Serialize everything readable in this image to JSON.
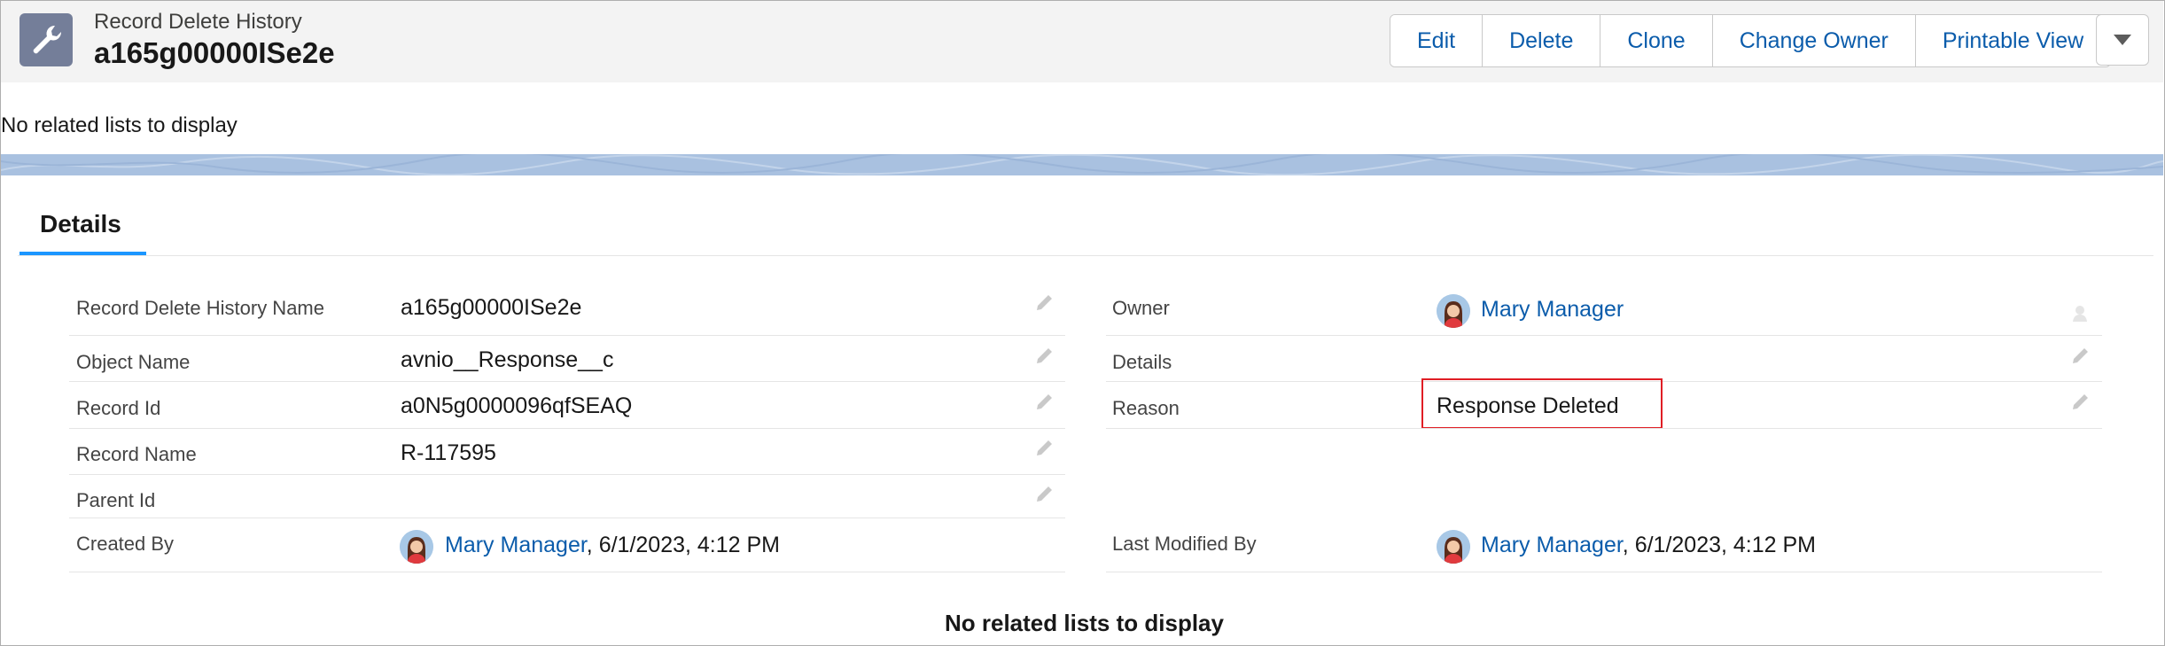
{
  "header": {
    "object_type": "Record Delete History",
    "record_name": "a165g00000ISe2e",
    "icon": "wrench-icon"
  },
  "actions": {
    "edit": "Edit",
    "delete": "Delete",
    "clone": "Clone",
    "change_owner": "Change Owner",
    "printable_view": "Printable View",
    "more_icon": "chevron-down-icon"
  },
  "related_top": "No related lists to display",
  "tabs": {
    "details": "Details"
  },
  "left_fields": {
    "record_delete_history_name": {
      "label": "Record Delete History Name",
      "value": "a165g00000ISe2e"
    },
    "object_name": {
      "label": "Object Name",
      "value": "avnio__Response__c"
    },
    "record_id": {
      "label": "Record Id",
      "value": "a0N5g0000096qfSEAQ"
    },
    "record_name": {
      "label": "Record Name",
      "value": "R-117595"
    },
    "parent_id": {
      "label": "Parent Id",
      "value": ""
    },
    "created_by": {
      "label": "Created By",
      "user": "Mary Manager",
      "date": ", 6/1/2023, 4:12 PM"
    }
  },
  "right_fields": {
    "owner": {
      "label": "Owner",
      "user": "Mary Manager"
    },
    "details": {
      "label": "Details",
      "value": ""
    },
    "reason": {
      "label": "Reason",
      "value": "Response Deleted"
    },
    "last_modified_by": {
      "label": "Last Modified By",
      "user": "Mary Manager",
      "date": ", 6/1/2023, 4:12 PM"
    }
  },
  "related_bottom": "No related lists to display",
  "colors": {
    "link": "#0b5cab",
    "tab_accent": "#1b96ff",
    "highlight": "#e01e25",
    "header_bg": "#f3f3f3",
    "icon_bg": "#747e99"
  }
}
